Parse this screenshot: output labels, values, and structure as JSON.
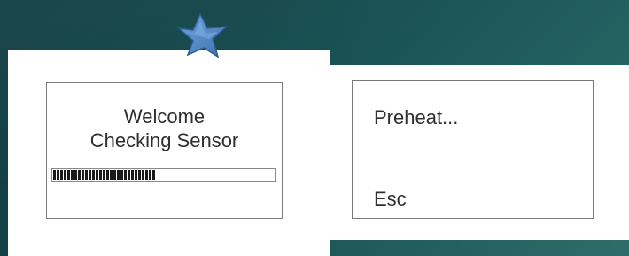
{
  "welcome_screen": {
    "line1": "Welcome",
    "line2": "Checking Sensor",
    "progress_fraction": 0.46
  },
  "preheat_screen": {
    "status": "Preheat...",
    "esc_label": "Esc"
  },
  "icons": {
    "pin": "pushpin-icon"
  },
  "colors": {
    "background": "#15484c",
    "panel": "#ffffff",
    "pin": "#4f86c6",
    "text": "#2f2f2f",
    "progress": "#1a1a1a"
  }
}
